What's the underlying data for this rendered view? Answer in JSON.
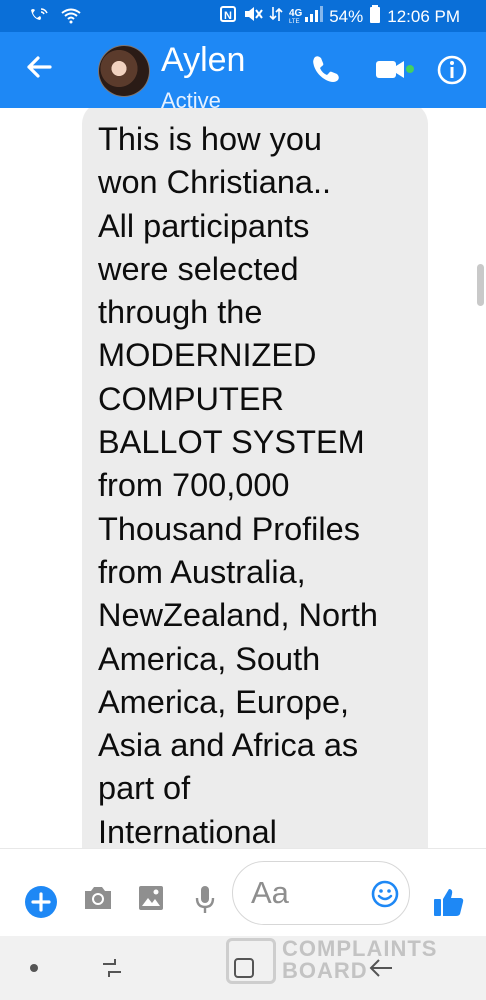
{
  "status_bar": {
    "battery": "54%",
    "time": "12:06 PM",
    "network": "4G LTE"
  },
  "header": {
    "contact_name": "Aylen",
    "contact_status": "Active"
  },
  "message": {
    "text": "This is how you\nwon Christiana..\nAll participants\nwere selected\nthrough the\nMODERNIZED\nCOMPUTER\nBALLOT SYSTEM\nfrom 700,000\nThousand Profiles\nfrom Australia,\nNewZealand, North\nAmerica, South\nAmerica, Europe,\nAsia and Africa as\npart of\nInternational"
  },
  "composer": {
    "placeholder": "Aa"
  },
  "watermark": {
    "line1": "COMPLAINTS",
    "line2": "BOARD"
  },
  "colors": {
    "header_blue": "#1e88f5",
    "status_blue": "#0a6fd8",
    "accent": "#1e88f5",
    "active_green": "#44d05f"
  }
}
